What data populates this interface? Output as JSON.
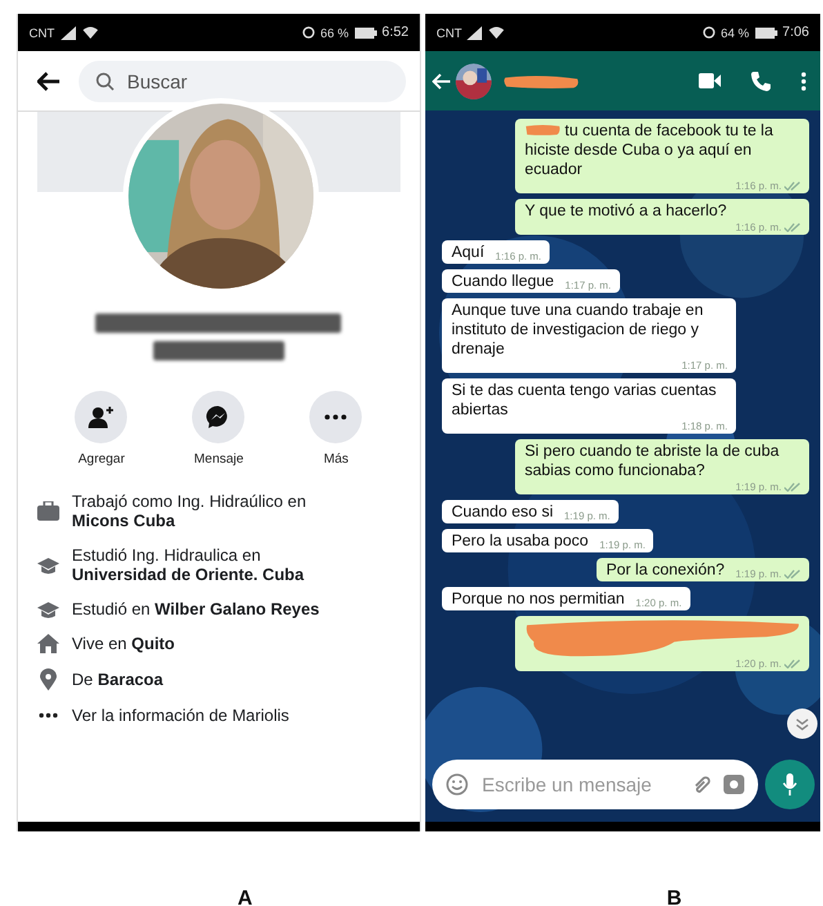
{
  "panels": [
    {
      "label": "A",
      "status_bar": {
        "carrier": "CNT",
        "battery": "66 %",
        "time": "6:52"
      },
      "search": {
        "placeholder": "Buscar"
      },
      "profile": {
        "name_blurred": true,
        "actions": [
          {
            "kind": "add-friend",
            "label": "Agregar"
          },
          {
            "kind": "messenger",
            "label": "Mensaje"
          },
          {
            "kind": "more",
            "label": "Más"
          }
        ],
        "details": [
          {
            "kind": "work",
            "text": "Trabajó como Ing. Hidraúlico en **Micons Cuba**"
          },
          {
            "kind": "school",
            "text": "Estudió Ing. Hidraulica en **Universidad de Oriente. Cuba**"
          },
          {
            "kind": "school",
            "text": "Estudió en **Wilber Galano Reyes**"
          },
          {
            "kind": "home",
            "text": "Vive en **Quito**"
          },
          {
            "kind": "place",
            "text": "De **Baracoa**"
          },
          {
            "kind": "more",
            "text": "Ver la información de Mariolis"
          }
        ]
      }
    },
    {
      "label": "B",
      "status_bar": {
        "carrier": "CNT",
        "battery": "64 %",
        "time": "7:06"
      },
      "chat": {
        "name_redacted": true,
        "messages": [
          {
            "kind": "out",
            "redacted": true,
            "text": "tu cuenta de facebook tu te la hiciste desde Cuba o ya aquí en ecuador",
            "time": "1:16 p. m."
          },
          {
            "kind": "out",
            "redacted": false,
            "text": "Y que te motivó a a hacerlo?",
            "time": "1:16 p. m."
          },
          {
            "kind": "in",
            "redacted": false,
            "text": "Aquí",
            "time": "1:16 p. m."
          },
          {
            "kind": "in",
            "redacted": false,
            "text": "Cuando llegue",
            "time": "1:17 p. m."
          },
          {
            "kind": "in",
            "redacted": false,
            "text": "Aunque tuve una cuando trabaje en instituto de investigacion de riego y drenaje",
            "time": "1:17 p. m."
          },
          {
            "kind": "in",
            "redacted": false,
            "text": "Si te das cuenta tengo varias cuentas abiertas",
            "time": "1:18 p. m."
          },
          {
            "kind": "out",
            "redacted": false,
            "text": "Si pero cuando te abriste la de cuba sabias como funcionaba?",
            "time": "1:19 p. m."
          },
          {
            "kind": "in",
            "redacted": false,
            "text": "Cuando eso si",
            "time": "1:19 p. m."
          },
          {
            "kind": "in",
            "redacted": false,
            "text": "Pero la usaba poco",
            "time": "1:19 p. m."
          },
          {
            "kind": "out",
            "redacted": false,
            "text": "Por la conexión?",
            "time": "1:19 p. m."
          },
          {
            "kind": "in",
            "redacted": false,
            "text": "Porque no nos permitian",
            "time": "1:20 p. m."
          },
          {
            "kind": "out",
            "redacted": true,
            "time": "1:20 p. m."
          }
        ],
        "input": {
          "placeholder": "Escribe un mensaje"
        }
      }
    }
  ]
}
